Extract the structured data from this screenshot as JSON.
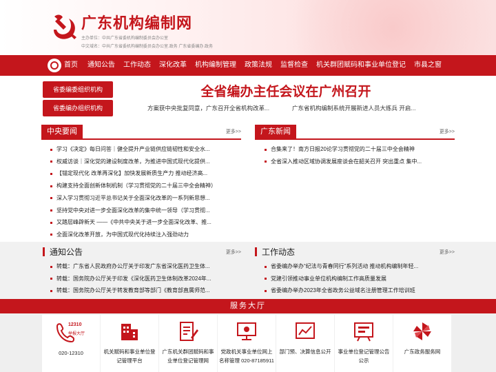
{
  "header": {
    "title": "广东机构编制网",
    "sponsor": "主办单位：中共广东省委机构编制委员会办公室",
    "domain": "中文域名：中共广东省委机构编制委员会办公室.政务  广东省委编办.政务"
  },
  "nav": [
    "首页",
    "通知公告",
    "工作动态",
    "深化改革",
    "机构编制管理",
    "政策法规",
    "监督检查",
    "机关群团赋码和事业单位登记",
    "市县之窗"
  ],
  "side_buttons": [
    "省委编委组织机构",
    "省委编办组织机构"
  ],
  "headline": {
    "title": "全省编办主任会议在广州召开",
    "sub_left": "方案获中央批复同意，广东召开全省机构改革...",
    "sub_right": "广东省机构编制系统开展新进人员大练兵 开启..."
  },
  "central_news": {
    "title": "中央要闻",
    "more": "更多>>",
    "items": [
      "学习《决定》每日问答｜健全提升产业链供应链韧性和安全水...",
      "权威访谈｜深化党的建设制度改革，为推进中国式现代化提供...",
      "【锚定现代化 改革再深化】加快发展新质生产力 推动经济高...",
      "构建支持全面创新体制机制（学习贯彻党的二十届三中全会精神）",
      "深入学习贯彻习近平总书记关于全面深化改革的一系列新思想...",
      "坚持党中央对进一步全面深化改革的集中统一领导（学习贯彻...",
      "又踏层峰辟新天 ——《中共中央关于进一步全面深化改革、推...",
      "全面深化改革开放，为中国式现代化持续注入强劲动力"
    ]
  },
  "gd_news": {
    "title": "广东新闻",
    "more": "更多>>",
    "items": [
      "合集来了！南方日报20论学习贯彻党的二十届三中全会精神",
      "全省深入推动区域协调发展座谈会在韶关召开 突出重点 集中..."
    ]
  },
  "notice": {
    "title": "通知公告",
    "more": "更多>>",
    "items": [
      "转载：广东省人民政府办公厅关于印发广东省深化医药卫生体...",
      "转载：国务院办公厅关于印发《深化医药卫生体制改革2024年...",
      "转载：国务院办公厅关于转发教育部等部门《教育部直属师范..."
    ]
  },
  "work": {
    "title": "工作动态",
    "more": "更多>>",
    "items": [
      "省委编办举办“纪法与青春同行”系列活动 推动机构编制年轻...",
      "党建引领推动事业单位机构编制工作高质量发展",
      "省委编办举办2023年全省政务公益域名注册管理工作培训班"
    ]
  },
  "service_hall": {
    "title": "服务大厅",
    "cards": [
      {
        "icon": "phone-hotline-icon",
        "badge_line1": "12310",
        "badge_line2": "举报大厅",
        "label": "020-12310"
      },
      {
        "icon": "building-icon",
        "label": "机关赋码和事业单位登记管理平台"
      },
      {
        "icon": "document-pen-icon",
        "label": "广东机关群团赋码和事业单位登记管理网"
      },
      {
        "icon": "monitor-icon",
        "label": "党政机关事业单位网上名称管理 020-87185911"
      },
      {
        "icon": "chart-icon",
        "label": "部门预、决算信息公开"
      },
      {
        "icon": "info-board-icon",
        "label": "事业单位登记管理公告公示"
      },
      {
        "icon": "pinwheel-logo-icon",
        "label": "广东政务服务网"
      }
    ]
  },
  "colors": {
    "accent": "#c4161c",
    "band": "#f1f1f1"
  }
}
